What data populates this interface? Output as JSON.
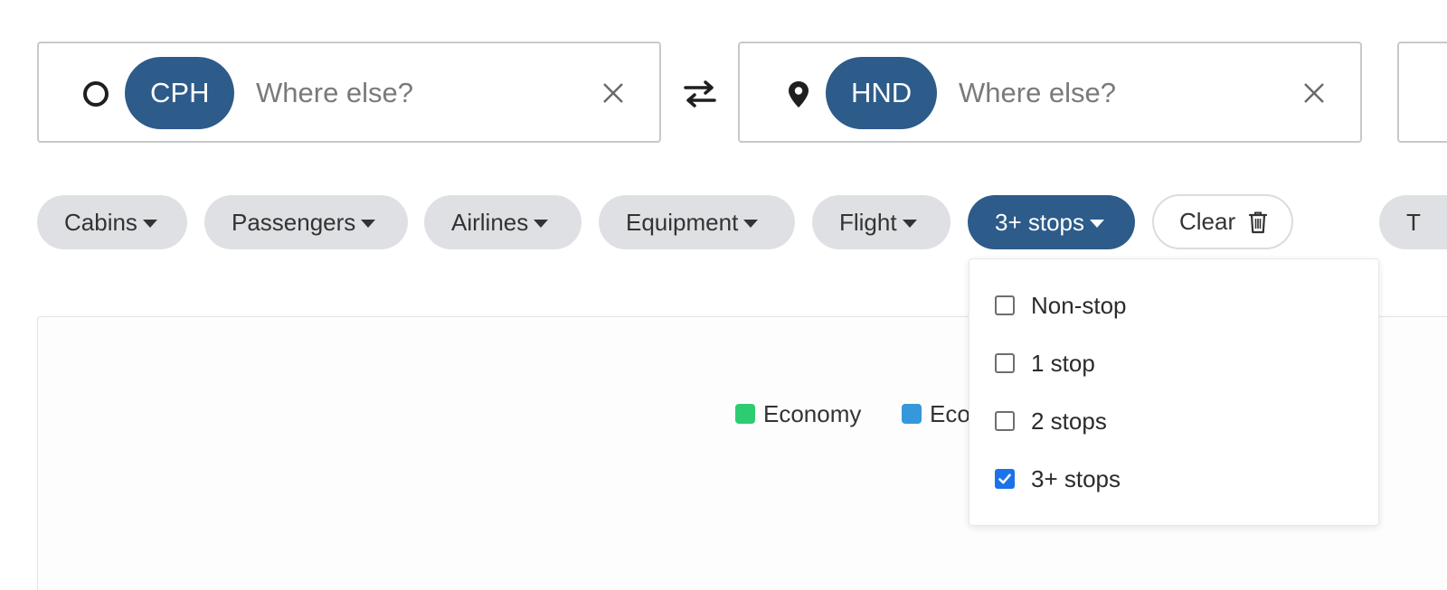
{
  "origin": {
    "code": "CPH",
    "placeholder": "Where else?",
    "value": ""
  },
  "destination": {
    "code": "HND",
    "placeholder": "Where else?",
    "value": ""
  },
  "filters": {
    "cabins": "Cabins",
    "passengers": "Passengers",
    "airlines": "Airlines",
    "equipment": "Equipment",
    "flight": "Flight",
    "stops": "3+ stops",
    "clear": "Clear",
    "partial": "T"
  },
  "stops_dropdown": {
    "options": [
      {
        "label": "Non-stop",
        "checked": false
      },
      {
        "label": "1 stop",
        "checked": false
      },
      {
        "label": "2 stops",
        "checked": false
      },
      {
        "label": "3+ stops",
        "checked": true
      }
    ]
  },
  "chart": {
    "legend": [
      {
        "label": "Economy",
        "color": "#2ecc71"
      },
      {
        "label": "Eco",
        "color": "#3498db"
      }
    ]
  },
  "colors": {
    "accent": "#2d5b8a",
    "chip_bg": "#dfe0e3",
    "checkbox_checked": "#1a73e8"
  },
  "icons": {
    "origin": "circle-outline-icon",
    "destination": "map-pin-icon",
    "swap": "swap-arrows-icon",
    "clear": "trash-icon",
    "remove": "close-icon"
  }
}
